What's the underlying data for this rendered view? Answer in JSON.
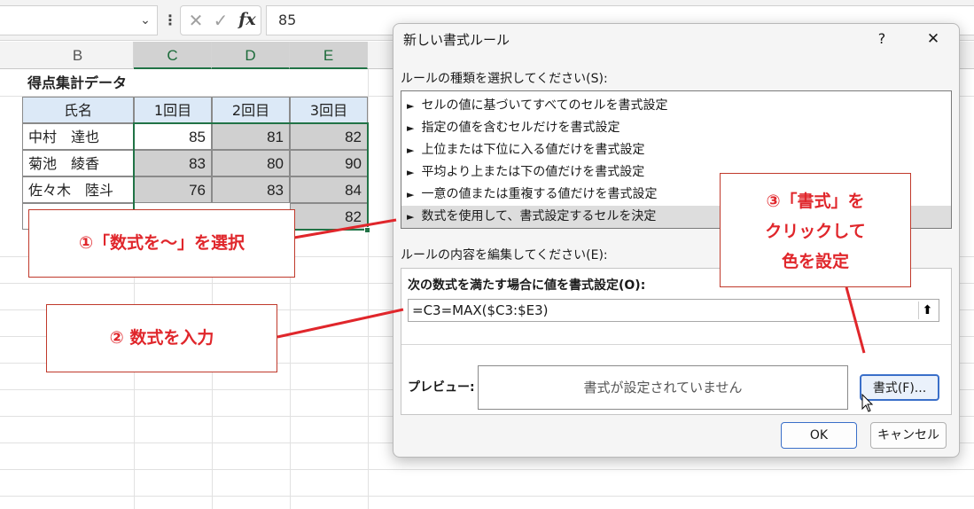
{
  "formula_bar": {
    "formula": "85",
    "fx_label": "fx"
  },
  "sheet": {
    "columns": [
      "B",
      "C",
      "D",
      "E"
    ],
    "title": "得点集計データ",
    "table_headers": [
      "氏名",
      "1回目",
      "2回目",
      "3回目"
    ],
    "rows": [
      {
        "name": "中村　達也",
        "scores": [
          "85",
          "81",
          "82"
        ]
      },
      {
        "name": "菊池　綾香",
        "scores": [
          "83",
          "80",
          "90"
        ]
      },
      {
        "name": "佐々木　陸斗",
        "scores": [
          "76",
          "83",
          "84"
        ]
      },
      {
        "name": "",
        "scores": [
          "",
          "",
          "82"
        ]
      }
    ]
  },
  "dialog": {
    "title": "新しい書式ルール",
    "help": "?",
    "close": "✕",
    "rule_type_label": "ルールの種類を選択してください(S):",
    "rule_types": [
      "セルの値に基づいてすべてのセルを書式設定",
      "指定の値を含むセルだけを書式設定",
      "上位または下位に入る値だけを書式設定",
      "平均より上または下の値だけを書式設定",
      "一意の値または重複する値だけを書式設定",
      "数式を使用して、書式設定するセルを決定"
    ],
    "edit_label": "ルールの内容を編集してください(E):",
    "formula_label": "次の数式を満たす場合に値を書式設定(O):",
    "formula_value": "=C3=MAX($C3:$E3)",
    "preview_label": "プレビュー:",
    "preview_text": "書式が設定されていません",
    "format_button": "書式(F)...",
    "ok_button": "OK",
    "cancel_button": "キャンセル"
  },
  "annotations": {
    "step1": "①「数式を～」を選択",
    "step2": "② 数式を入力",
    "step3_line1": "③「書式」を",
    "step3_line2": "クリックして",
    "step3_line3": "色を設定"
  },
  "colors": {
    "callout_red": "#e0262b",
    "header_blue": "#dce9f7",
    "selection_green": "#217346"
  }
}
